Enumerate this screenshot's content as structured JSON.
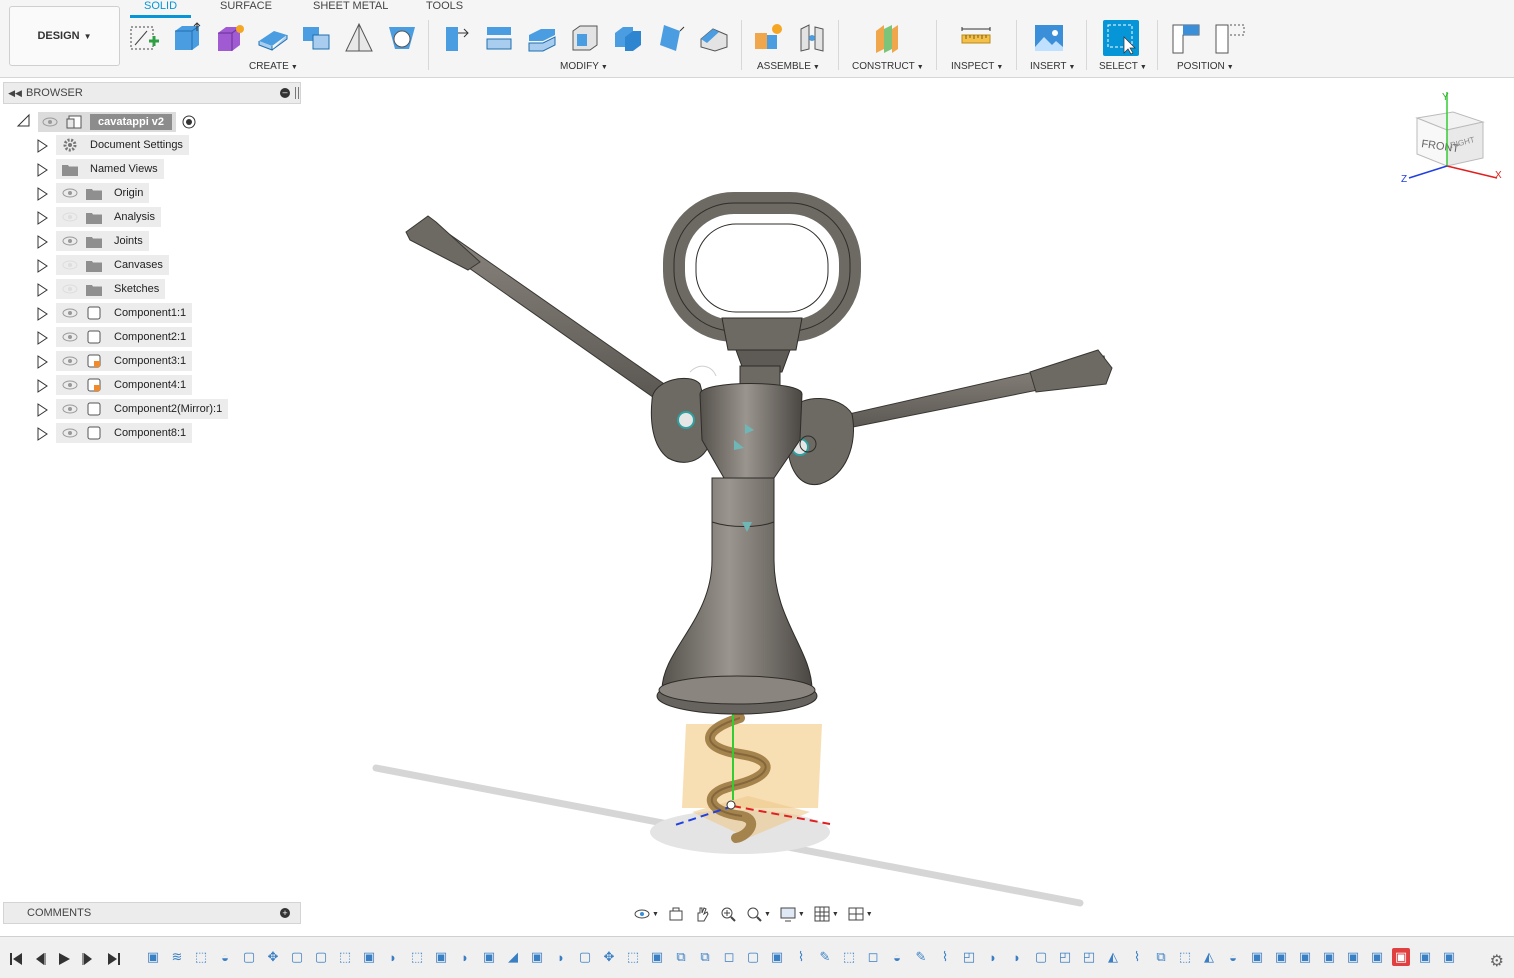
{
  "toolbar": {
    "workspace": "DESIGN",
    "tabs": [
      "SOLID",
      "SURFACE",
      "SHEET METAL",
      "TOOLS"
    ],
    "groups": {
      "create": "CREATE",
      "modify": "MODIFY",
      "assemble": "ASSEMBLE",
      "construct": "CONSTRUCT",
      "inspect": "INSPECT",
      "insert": "INSERT",
      "select": "SELECT",
      "position": "POSITION"
    },
    "accent": "#0696d7"
  },
  "browser": {
    "title": "BROWSER",
    "root": "cavatappi v2",
    "items": [
      {
        "label": "Document Settings",
        "icon": "gear-icon"
      },
      {
        "label": "Named Views",
        "icon": "folder-icon"
      },
      {
        "label": "Origin",
        "icon": "folder-icon"
      },
      {
        "label": "Analysis",
        "icon": "folder-icon"
      },
      {
        "label": "Joints",
        "icon": "folder-icon"
      },
      {
        "label": "Canvases",
        "icon": "folder-icon"
      },
      {
        "label": "Sketches",
        "icon": "folder-icon"
      },
      {
        "label": "Component1:1",
        "icon": "component-icon"
      },
      {
        "label": "Component2:1",
        "icon": "component-icon"
      },
      {
        "label": "Component3:1",
        "icon": "component-linked-icon"
      },
      {
        "label": "Component4:1",
        "icon": "component-linked-icon"
      },
      {
        "label": "Component2(Mirror):1",
        "icon": "component-icon"
      },
      {
        "label": "Component8:1",
        "icon": "component-icon"
      }
    ]
  },
  "comments": {
    "title": "COMMENTS"
  },
  "viewcube": {
    "front": "FRONT",
    "right": "RIGHT",
    "x": "X",
    "y": "Y",
    "z": "Z"
  },
  "model": {
    "body_color": "#77726b",
    "worm_color": "#a4834d",
    "plane_color": "#f6d39a"
  },
  "navbar": [
    "orbit-icon",
    "look-at-icon",
    "pan-icon",
    "zoom-icon",
    "fit-icon",
    "display-settings-icon",
    "grid-icon",
    "viewports-icon"
  ],
  "timeline": {
    "feature_count": 55,
    "active_feature": 52
  }
}
